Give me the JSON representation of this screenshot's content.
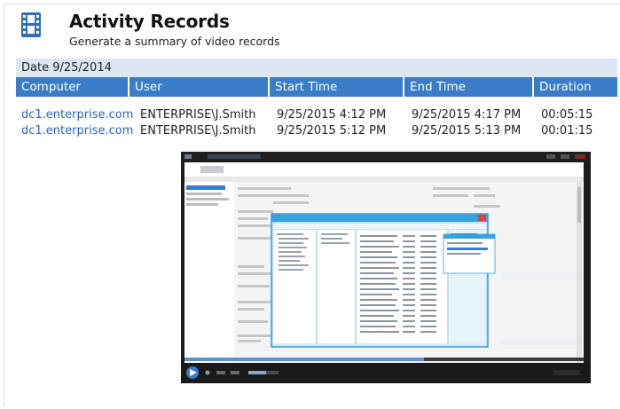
{
  "header": {
    "title": "Activity Records",
    "subtitle": "Generate a summary of video records",
    "icon": "film-reel-icon"
  },
  "date_bar": {
    "label": "Date 9/25/2014"
  },
  "table": {
    "columns": [
      "Computer",
      "User",
      "Start Time",
      "End Time",
      "Duration"
    ],
    "rows": [
      {
        "computer": "dc1.enterprise.com",
        "user": "ENTERPRISE\\J.Smith",
        "start": "9/25/2015 4:12 PM",
        "end": "9/25/2015 4:17 PM",
        "duration": "00:05:15"
      },
      {
        "computer": "dc1.enterprise.com",
        "user": "ENTERPRISE\\J.Smith",
        "start": "9/25/2015 5:12 PM",
        "end": "9/25/2015 5:13 PM",
        "duration": "00:01:15"
      }
    ]
  },
  "video_thumbnail": {
    "content": "screen-recording-preview"
  },
  "colors": {
    "accent": "#3a7cc7",
    "date_bar": "#dce7f3",
    "link": "#2d63b4",
    "icon": "#2e6fb8"
  }
}
